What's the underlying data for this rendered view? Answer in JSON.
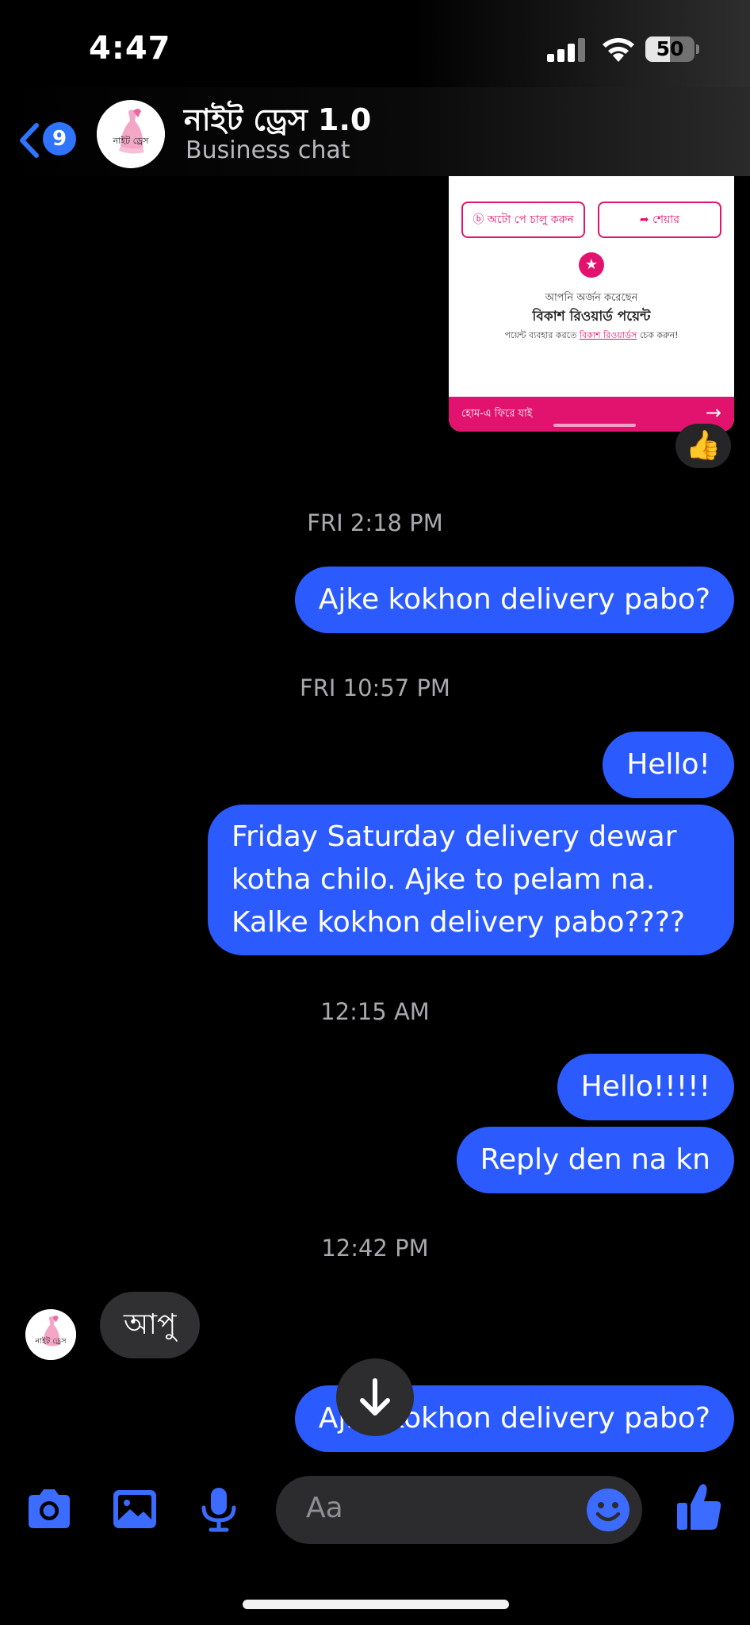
{
  "status_bar": {
    "time": "4:47",
    "battery": "50",
    "battery_level": 0.5
  },
  "header": {
    "back_badge": "9",
    "title": "নাইট ড্রেস 1.0",
    "subtitle": "Business chat",
    "avatar_text": "নাইট ড্রেস",
    "accent": "#2f74ff"
  },
  "shared_card": {
    "autopay_button": "অটো পে চালু করুন",
    "share_button": "শেয়ার",
    "earned_text": "আপনি অর্জন করেছেন",
    "reward_title": "বিকাশ রিওয়ার্ড পয়েন্ট",
    "reward_note_before": "পয়েন্ট ব্যবহার করতে",
    "reward_note_link": "বিকাশ রিওয়ার্ডস",
    "reward_note_after": "চেক করুন!",
    "home_back": "হোম-এ ফিরে যাই",
    "brand_color": "#e2136e",
    "reaction": "👍"
  },
  "messages": [
    {
      "type": "timestamp",
      "text": "FRI 2:18 PM"
    },
    {
      "type": "outgoing",
      "text": "Ajke kokhon delivery pabo?"
    },
    {
      "type": "timestamp",
      "text": "FRI 10:57 PM"
    },
    {
      "type": "outgoing",
      "text": "Hello!"
    },
    {
      "type": "outgoing",
      "text": "Friday Saturday delivery dewar kotha chilo. Ajke to pelam na. Kalke kokhon delivery pabo????"
    },
    {
      "type": "timestamp",
      "text": "12:15 AM"
    },
    {
      "type": "outgoing",
      "text": "Hello!!!!!"
    },
    {
      "type": "outgoing",
      "text": "Reply den na kn"
    },
    {
      "type": "timestamp",
      "text": "12:42 PM"
    },
    {
      "type": "incoming",
      "text": "আপু"
    },
    {
      "type": "outgoing",
      "text": "Ajke kokhon delivery pabo?"
    }
  ],
  "composer": {
    "placeholder": "Aa",
    "icons": [
      "camera-icon",
      "gallery-icon",
      "microphone-icon",
      "emoji-icon",
      "thumbs-up-icon"
    ]
  },
  "colors": {
    "outgoing_bubble": "#2b5bff",
    "incoming_bubble": "#303032",
    "icon_blue": "#3b6bff"
  }
}
